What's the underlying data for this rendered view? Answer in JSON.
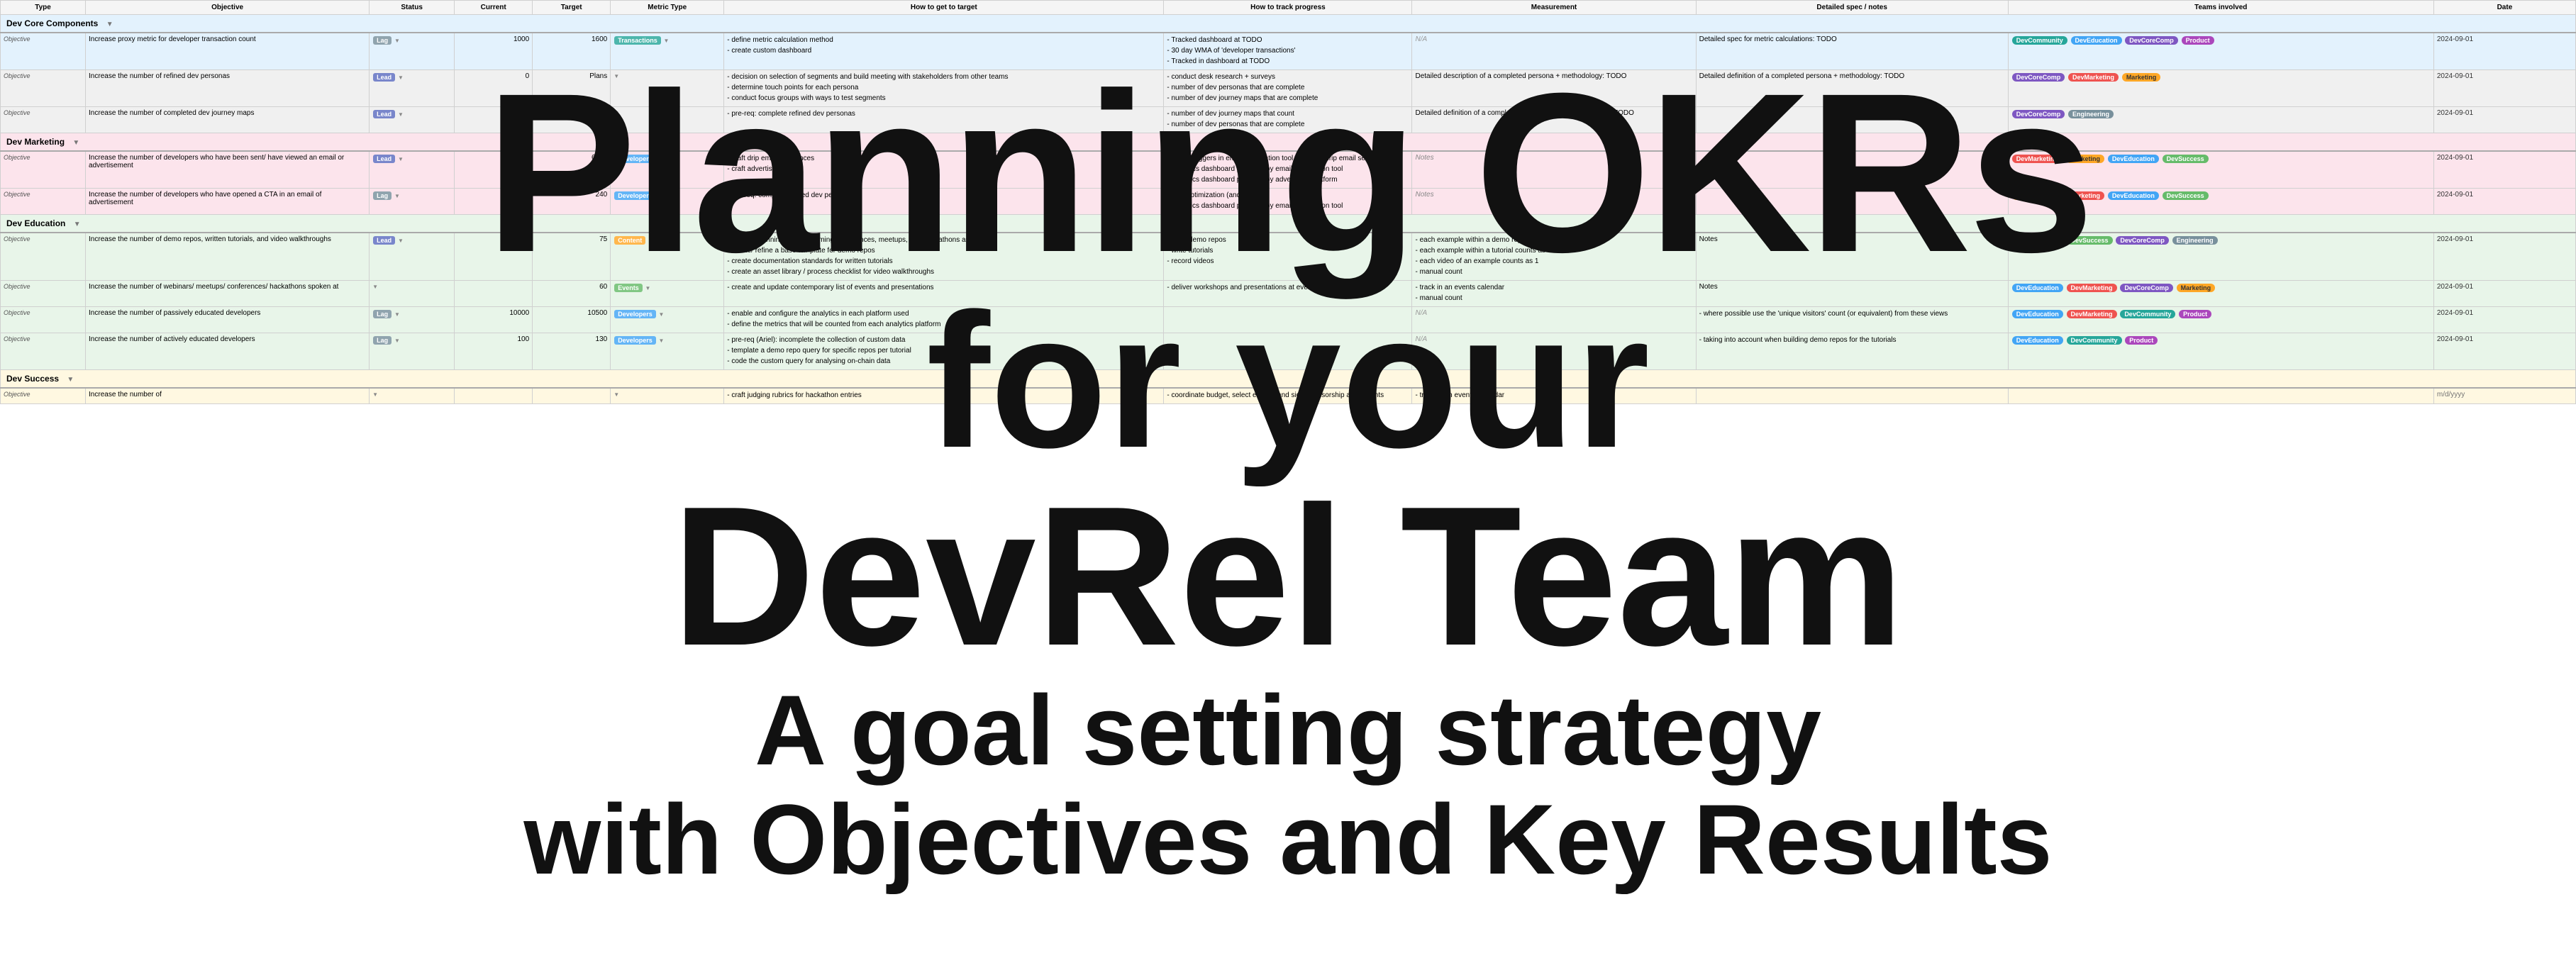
{
  "overlay": {
    "line1": "Planning OKRs",
    "line2": "for your",
    "line3": "DevRel Team",
    "line4": "A goal setting strategy\nwith Objectives and Key Results"
  },
  "header": {
    "tracked_dashboard": "Tracked dashboard at TODO"
  },
  "columns": {
    "type": "Type",
    "objective": "Objective",
    "status": "Status",
    "current": "Current",
    "target": "Target",
    "metric_type": "Metric Type",
    "howto": "How to get to target",
    "tracking": "How to track progress",
    "measurement": "Measurement",
    "spec": "Detailed spec / notes",
    "teams": "Teams involved",
    "date": "Date"
  },
  "sections": [
    {
      "id": "dev-core",
      "label": "Dev Core Components",
      "color": "section-dev-core",
      "rows": [
        {
          "type": "Objective",
          "objective": "Increase proxy metric for developer transaction count",
          "status_tag": "Lag",
          "status_class": "tag-lag",
          "current": "1000",
          "target": "1600",
          "metric_tag": "Transactions",
          "metric_class": "tag-transactions",
          "howto": [
            "define metric calculation method",
            "create custom dashboard"
          ],
          "tracking": [
            "Tracked dashboard at TODO",
            "30 day WMA of 'developer transactions'",
            "Tracked in dashboard at TODO"
          ],
          "measurement": "N/A",
          "spec": "Detailed spec for metric calculations: TODO",
          "teams": [
            {
              "label": "DevCommunity",
              "class": "tag-devcommunity"
            },
            {
              "label": "DevEducation",
              "class": "tag-deveducation"
            },
            {
              "label": "DevCoreComp",
              "class": "tag-devcorecomp"
            },
            {
              "label": "Product",
              "class": "tag-product"
            }
          ],
          "date": "2024-09-01"
        }
      ]
    },
    {
      "id": "dev-core-2",
      "label": "",
      "color": "",
      "rows": [
        {
          "type": "Objective",
          "objective": "Increase the number of refined dev personas",
          "status_tag": "Lead",
          "status_class": "tag-lead",
          "current": "0",
          "target": "Plans",
          "metric_tag": "",
          "metric_class": "",
          "howto": [
            "decision on selection of segments and build meeting with stakeholders from other teams",
            "determine touch points for each persona",
            "conduct focus groups with ways to test segments"
          ],
          "tracking": [
            "conduct desk research + surveys",
            "number of dev personas that are complete",
            "number of dev journey maps that are complete"
          ],
          "measurement": "Detailed description of a completed persona + methodology: TODO",
          "spec": "Detailed definition of a completed persona + methodology: TODO",
          "teams": [
            {
              "label": "DevCoreComp",
              "class": "tag-devcorecomp"
            },
            {
              "label": "DevMarketing",
              "class": "tag-devmarketing"
            },
            {
              "label": "Marketing",
              "class": "tag-marketing"
            }
          ],
          "date": "2024-09-01"
        },
        {
          "type": "Objective",
          "objective": "Increase the number of completed dev journey maps",
          "status_tag": "Lead",
          "status_class": "tag-lead",
          "current": "0",
          "target": "Plans",
          "metric_tag": "",
          "metric_class": "",
          "howto": [
            "pre-req: complete refined dev personas"
          ],
          "tracking": [
            "number of dev journey maps that count",
            "number of dev personas that are complete"
          ],
          "measurement": "Detailed definition of a completed journey map + methodology: TODO",
          "spec": "",
          "teams": [
            {
              "label": "DevCoreComp",
              "class": "tag-devcorecomp"
            },
            {
              "label": "Engineering",
              "class": "tag-engineering"
            }
          ],
          "date": "2024-09-01"
        }
      ]
    },
    {
      "id": "dev-marketing",
      "label": "Dev Marketing",
      "color": "section-dev-marketing",
      "rows": [
        {
          "type": "Objective",
          "objective": "Increase the number of developers who have been sent/ have viewed an email or advertisement",
          "status_tag": "Lead",
          "status_class": "tag-lead",
          "current": "5000",
          "target": "6000",
          "metric_tag": "Developers",
          "metric_class": "tag-developers",
          "howto": [
            "craft drip email sequences",
            "craft advertisements"
          ],
          "tracking": [
            "set up triggers in email automation tool to trigger drip email sequences",
            "Analytics dashboard provided by email automation tool",
            "Analytics dashboard provided by advertising platform"
          ],
          "measurement": "Notes",
          "spec": "",
          "teams": [
            {
              "label": "DevMarketing",
              "class": "tag-devmarketing"
            },
            {
              "label": "Marketing",
              "class": "tag-marketing"
            },
            {
              "label": "DevEducation",
              "class": "tag-deveducation"
            },
            {
              "label": "DevSuccess",
              "class": "tag-devsuccess"
            }
          ],
          "date": "2024-09-01"
        },
        {
          "type": "Objective",
          "objective": "Increase the number of developers who have opened a CTA in an email of advertisement",
          "status_tag": "Lag",
          "status_class": "tag-lag",
          "current": "200",
          "target": "240",
          "metric_tag": "Developers",
          "metric_class": "tag-developers",
          "howto": [
            "pre-req: compete refined dev personas"
          ],
          "tracking": [
            "CTA optimization (and others)",
            "Analytics dashboard provided by email automation tool"
          ],
          "measurement": "Notes",
          "spec": "",
          "teams": [
            {
              "label": "Marketing",
              "class": "tag-marketing"
            },
            {
              "label": "DevMarketing",
              "class": "tag-devmarketing"
            },
            {
              "label": "DevEducation",
              "class": "tag-deveducation"
            },
            {
              "label": "DevSuccess",
              "class": "tag-devsuccess"
            }
          ],
          "date": "2024-09-01"
        }
      ]
    },
    {
      "id": "dev-education",
      "label": "Dev Education",
      "color": "section-dev-education",
      "rows": [
        {
          "type": "Objective",
          "objective": "Increase the number of demo repos, written tutorials, and video walkthroughs",
          "status_tag": "Lead",
          "status_class": "tag-lead",
          "current": "50",
          "target": "75",
          "metric_tag": "Content",
          "metric_class": "tag-content",
          "howto": [
            "content planning - use upcoming conferences, meetups, and hackathons as inputs",
            "create/ refine a base template for demo repos",
            "create documentation standards for written tutorials",
            "create an asset library / process checklist for video walkthroughs"
          ],
          "tracking": [
            "code demo repos",
            "write tutorials",
            "record videos"
          ],
          "measurement": [
            "each example within a demo repo counts as 1",
            "each example within a tutorial counts as 1",
            "each video of an example counts as 1",
            "manual count"
          ],
          "spec": "Notes",
          "teams": [
            {
              "label": "DevEducation",
              "class": "tag-deveducation"
            },
            {
              "label": "DevSuccess",
              "class": "tag-devsuccess"
            },
            {
              "label": "DevCoreComp",
              "class": "tag-devcorecomp"
            },
            {
              "label": "Engineering",
              "class": "tag-engineering"
            }
          ],
          "date": "2024-09-01"
        },
        {
          "type": "Objective",
          "objective": "Increase the number of webinars/ meetups/ conferences/ hackathons spoken at",
          "status_tag": "",
          "status_class": "",
          "current": "",
          "target": "60",
          "metric_tag": "Events",
          "metric_class": "tag-events",
          "howto": [
            "create and update contemporary list of events and presentations"
          ],
          "tracking": [
            "deliver workshops and presentations at events/ webinars"
          ],
          "measurement": [
            "track in an events calendar",
            "manual count"
          ],
          "spec": "Notes",
          "teams": [
            {
              "label": "DevEducation",
              "class": "tag-deveducation"
            },
            {
              "label": "DevMarketing",
              "class": "tag-devmarketing"
            },
            {
              "label": "DevCoreComp",
              "class": "tag-devcorecomp"
            },
            {
              "label": "Marketing",
              "class": "tag-marketing"
            }
          ],
          "date": "2024-09-01"
        },
        {
          "type": "Objective",
          "objective": "Increase the number of passively educated developers",
          "status_tag": "Lag",
          "status_class": "tag-lag",
          "current": "10000",
          "target": "10500",
          "metric_tag": "Developers",
          "metric_class": "tag-developers",
          "howto": [
            "enable and configure the analytics in each platform used",
            "define the metrics that will be counted from each analytics platform"
          ],
          "tracking": [],
          "measurement": "N/A",
          "spec": [
            "where possible use the 'unique visitors' count (or equivalent) from these views"
          ],
          "teams": [
            {
              "label": "DevEducation",
              "class": "tag-deveducation"
            },
            {
              "label": "DevMarketing",
              "class": "tag-devmarketing"
            },
            {
              "label": "DevCommunity",
              "class": "tag-devcommunity"
            },
            {
              "label": "Product",
              "class": "tag-product"
            }
          ],
          "date": "2024-09-01"
        },
        {
          "type": "Objective",
          "objective": "Increase the number of actively educated developers",
          "status_tag": "Lag",
          "status_class": "tag-lag",
          "current": "100",
          "target": "130",
          "metric_tag": "Developers",
          "metric_class": "tag-developers",
          "howto": [
            "pre-req (Ariel): incomplete the collection of custom data",
            "template a demo repo query for specific repos per tutorial",
            "code the custom query for analysing on-chain data"
          ],
          "tracking": [],
          "measurement": "N/A",
          "spec": [
            "taking into account when building demo repos for the tutorials"
          ],
          "teams": [
            {
              "label": "DevEducation",
              "class": "tag-deveducation"
            },
            {
              "label": "DevCommunity",
              "class": "tag-devcommunity"
            },
            {
              "label": "Product",
              "class": "tag-product"
            }
          ],
          "date": "2024-09-01"
        }
      ]
    },
    {
      "id": "dev-success",
      "label": "Dev Success",
      "color": "section-dev-success",
      "rows": [
        {
          "type": "Objective",
          "objective": "Increase the number of",
          "status_tag": "",
          "status_class": "",
          "current": "",
          "target": "",
          "metric_tag": "",
          "metric_class": "",
          "howto": [
            "craft judging rubrics for hackathon entries"
          ],
          "tracking": [
            "coordinate budget, select events, and sign sponsorship agreements"
          ],
          "measurement": [
            "track in an events calendar"
          ],
          "spec": "",
          "teams": [],
          "date": ""
        }
      ]
    }
  ]
}
